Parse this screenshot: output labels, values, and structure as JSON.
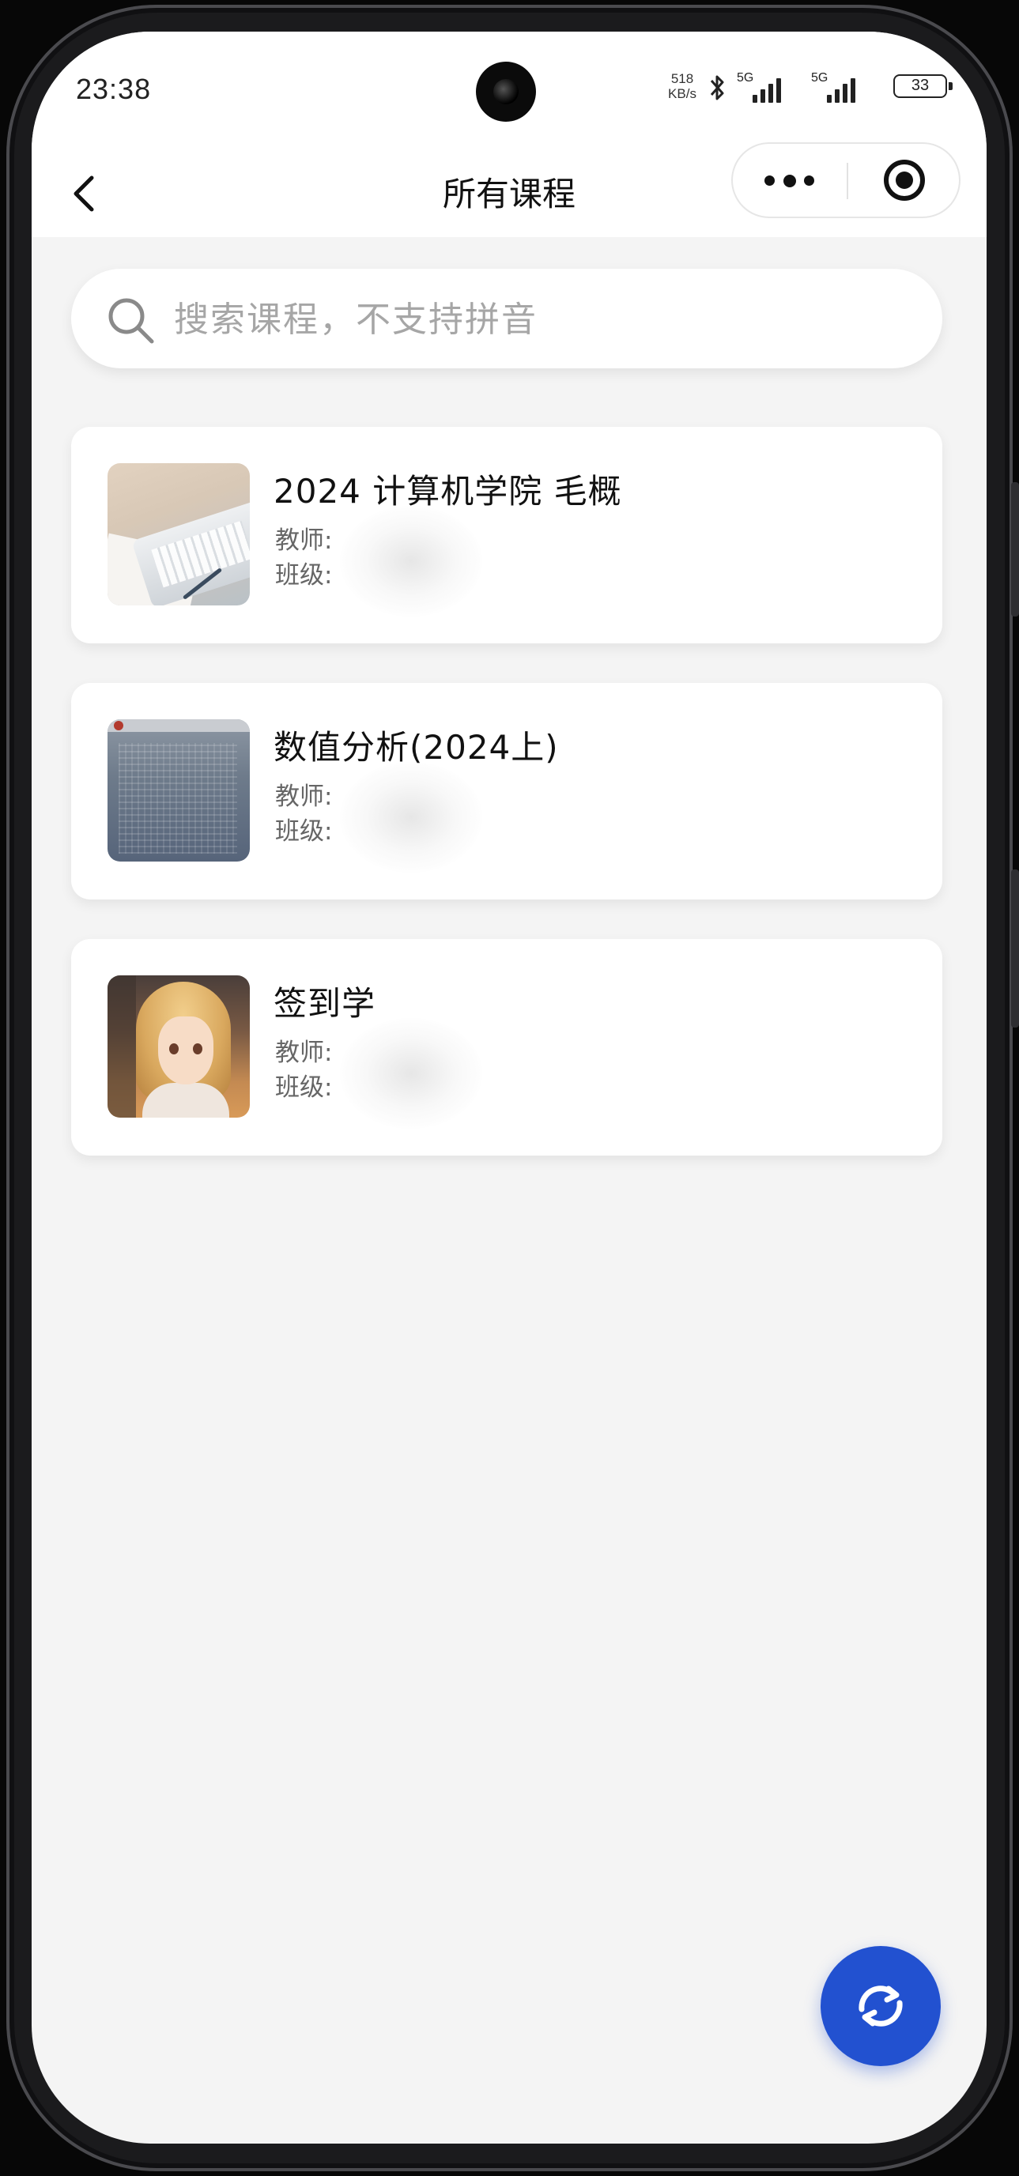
{
  "status_bar": {
    "time": "23:38",
    "net_speed_value": "518",
    "net_speed_unit": "KB/s",
    "sim1_label": "5G",
    "sim2_label": "5G",
    "battery_level": "33"
  },
  "nav": {
    "title": "所有课程"
  },
  "search": {
    "placeholder": "搜索课程，不支持拼音"
  },
  "courses": [
    {
      "name": "2024 计算机学院 毛概",
      "teacher_label": "教师:",
      "class_label": "班级:",
      "thumbnail": "desk-laptop-image"
    },
    {
      "name": "数值分析(2024上)",
      "teacher_label": "教师:",
      "class_label": "班级:",
      "thumbnail": "document-photo-image"
    },
    {
      "name": "签到学",
      "teacher_label": "教师:",
      "class_label": "班级:",
      "thumbnail": "anime-girl-image"
    }
  ],
  "colors": {
    "accent": "#2251d0",
    "background": "#f4f4f4",
    "card": "#ffffff"
  },
  "icons": {
    "back": "chevron-left-icon",
    "more": "more-dots-icon",
    "close": "target-circle-icon",
    "search": "search-icon",
    "refresh": "refresh-icon"
  }
}
